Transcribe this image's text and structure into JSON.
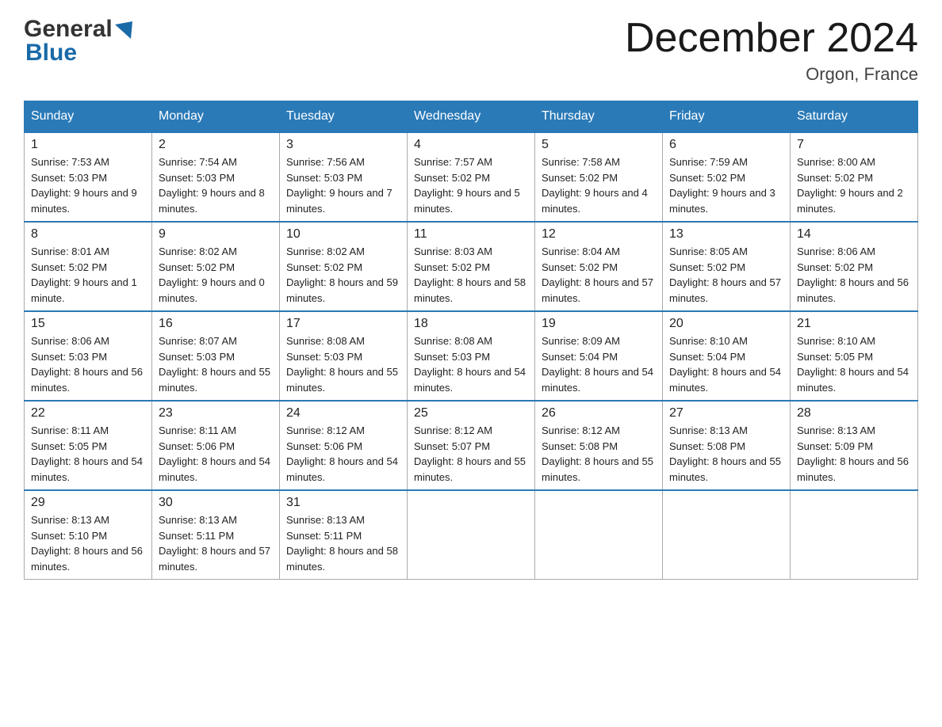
{
  "header": {
    "logo_text_general": "General",
    "logo_text_blue": "Blue",
    "month_title": "December 2024",
    "location": "Orgon, France"
  },
  "days_of_week": [
    "Sunday",
    "Monday",
    "Tuesday",
    "Wednesday",
    "Thursday",
    "Friday",
    "Saturday"
  ],
  "weeks": [
    [
      {
        "day": "1",
        "sunrise": "7:53 AM",
        "sunset": "5:03 PM",
        "daylight": "9 hours and 9 minutes."
      },
      {
        "day": "2",
        "sunrise": "7:54 AM",
        "sunset": "5:03 PM",
        "daylight": "9 hours and 8 minutes."
      },
      {
        "day": "3",
        "sunrise": "7:56 AM",
        "sunset": "5:03 PM",
        "daylight": "9 hours and 7 minutes."
      },
      {
        "day": "4",
        "sunrise": "7:57 AM",
        "sunset": "5:02 PM",
        "daylight": "9 hours and 5 minutes."
      },
      {
        "day": "5",
        "sunrise": "7:58 AM",
        "sunset": "5:02 PM",
        "daylight": "9 hours and 4 minutes."
      },
      {
        "day": "6",
        "sunrise": "7:59 AM",
        "sunset": "5:02 PM",
        "daylight": "9 hours and 3 minutes."
      },
      {
        "day": "7",
        "sunrise": "8:00 AM",
        "sunset": "5:02 PM",
        "daylight": "9 hours and 2 minutes."
      }
    ],
    [
      {
        "day": "8",
        "sunrise": "8:01 AM",
        "sunset": "5:02 PM",
        "daylight": "9 hours and 1 minute."
      },
      {
        "day": "9",
        "sunrise": "8:02 AM",
        "sunset": "5:02 PM",
        "daylight": "9 hours and 0 minutes."
      },
      {
        "day": "10",
        "sunrise": "8:02 AM",
        "sunset": "5:02 PM",
        "daylight": "8 hours and 59 minutes."
      },
      {
        "day": "11",
        "sunrise": "8:03 AM",
        "sunset": "5:02 PM",
        "daylight": "8 hours and 58 minutes."
      },
      {
        "day": "12",
        "sunrise": "8:04 AM",
        "sunset": "5:02 PM",
        "daylight": "8 hours and 57 minutes."
      },
      {
        "day": "13",
        "sunrise": "8:05 AM",
        "sunset": "5:02 PM",
        "daylight": "8 hours and 57 minutes."
      },
      {
        "day": "14",
        "sunrise": "8:06 AM",
        "sunset": "5:02 PM",
        "daylight": "8 hours and 56 minutes."
      }
    ],
    [
      {
        "day": "15",
        "sunrise": "8:06 AM",
        "sunset": "5:03 PM",
        "daylight": "8 hours and 56 minutes."
      },
      {
        "day": "16",
        "sunrise": "8:07 AM",
        "sunset": "5:03 PM",
        "daylight": "8 hours and 55 minutes."
      },
      {
        "day": "17",
        "sunrise": "8:08 AM",
        "sunset": "5:03 PM",
        "daylight": "8 hours and 55 minutes."
      },
      {
        "day": "18",
        "sunrise": "8:08 AM",
        "sunset": "5:03 PM",
        "daylight": "8 hours and 54 minutes."
      },
      {
        "day": "19",
        "sunrise": "8:09 AM",
        "sunset": "5:04 PM",
        "daylight": "8 hours and 54 minutes."
      },
      {
        "day": "20",
        "sunrise": "8:10 AM",
        "sunset": "5:04 PM",
        "daylight": "8 hours and 54 minutes."
      },
      {
        "day": "21",
        "sunrise": "8:10 AM",
        "sunset": "5:05 PM",
        "daylight": "8 hours and 54 minutes."
      }
    ],
    [
      {
        "day": "22",
        "sunrise": "8:11 AM",
        "sunset": "5:05 PM",
        "daylight": "8 hours and 54 minutes."
      },
      {
        "day": "23",
        "sunrise": "8:11 AM",
        "sunset": "5:06 PM",
        "daylight": "8 hours and 54 minutes."
      },
      {
        "day": "24",
        "sunrise": "8:12 AM",
        "sunset": "5:06 PM",
        "daylight": "8 hours and 54 minutes."
      },
      {
        "day": "25",
        "sunrise": "8:12 AM",
        "sunset": "5:07 PM",
        "daylight": "8 hours and 55 minutes."
      },
      {
        "day": "26",
        "sunrise": "8:12 AM",
        "sunset": "5:08 PM",
        "daylight": "8 hours and 55 minutes."
      },
      {
        "day": "27",
        "sunrise": "8:13 AM",
        "sunset": "5:08 PM",
        "daylight": "8 hours and 55 minutes."
      },
      {
        "day": "28",
        "sunrise": "8:13 AM",
        "sunset": "5:09 PM",
        "daylight": "8 hours and 56 minutes."
      }
    ],
    [
      {
        "day": "29",
        "sunrise": "8:13 AM",
        "sunset": "5:10 PM",
        "daylight": "8 hours and 56 minutes."
      },
      {
        "day": "30",
        "sunrise": "8:13 AM",
        "sunset": "5:11 PM",
        "daylight": "8 hours and 57 minutes."
      },
      {
        "day": "31",
        "sunrise": "8:13 AM",
        "sunset": "5:11 PM",
        "daylight": "8 hours and 58 minutes."
      },
      null,
      null,
      null,
      null
    ]
  ],
  "labels": {
    "sunrise": "Sunrise:",
    "sunset": "Sunset:",
    "daylight": "Daylight:"
  }
}
